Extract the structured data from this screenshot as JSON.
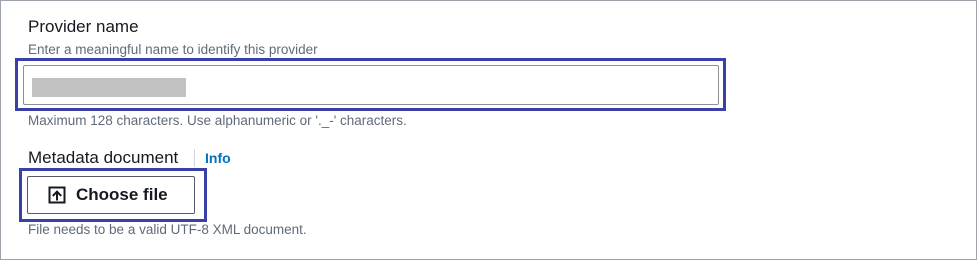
{
  "provider_name": {
    "label": "Provider name",
    "description": "Enter a meaningful name to identify this provider",
    "value": "",
    "constraint": "Maximum 128 characters. Use alphanumeric or '._-' characters."
  },
  "metadata_document": {
    "label": "Metadata document",
    "info_link": "Info",
    "choose_file_label": "Choose file",
    "upload_icon": "upload-icon",
    "constraint": "File needs to be a valid UTF-8 XML document."
  },
  "colors": {
    "highlight": "#3b3fa8",
    "link": "#0073bb",
    "label": "#16191f",
    "description": "#5f6b7a"
  }
}
